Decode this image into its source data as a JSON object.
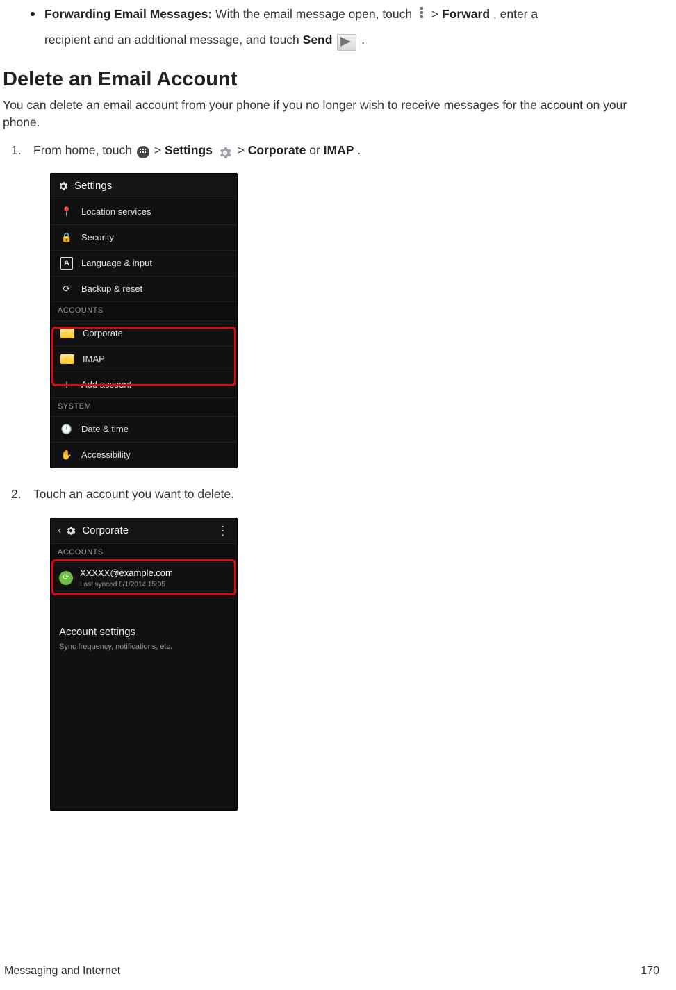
{
  "bullet": {
    "title": "Forwarding Email Messages:",
    "line1a": " With the email message open, touch ",
    "line1b": " > ",
    "forward": "Forward",
    "line1c": ", enter a",
    "line2a": "recipient and an additional message, and touch ",
    "send": "Send",
    "line2b": " ",
    "period": "."
  },
  "section_title": "Delete an Email Account",
  "section_para": "You can delete an email account from your phone if you no longer wish to receive messages for the account on your phone.",
  "step1": {
    "num": "1.",
    "a": "From home, touch ",
    "b": " > ",
    "settings": "Settings",
    "c": " ",
    "d": " > ",
    "corporate": "Corporate",
    "or": " or ",
    "imap": "IMAP",
    "period": "."
  },
  "step2": {
    "num": "2.",
    "text": "Touch an account you want to delete."
  },
  "phone1": {
    "header_title": "Settings",
    "rows": [
      {
        "icon": "📍",
        "label": "Location services"
      },
      {
        "icon": "🔒",
        "label": "Security"
      },
      {
        "icon": "A",
        "label": "Language & input"
      },
      {
        "icon": "⟳",
        "label": "Backup & reset"
      }
    ],
    "accounts_label": "ACCOUNTS",
    "accounts": [
      {
        "label": "Corporate"
      },
      {
        "label": "IMAP"
      }
    ],
    "add_account": "Add account",
    "system_label": "SYSTEM",
    "system": [
      {
        "icon": "🕘",
        "label": "Date & time"
      },
      {
        "icon": "✋",
        "label": "Accessibility"
      }
    ]
  },
  "phone2": {
    "header_title": "Corporate",
    "accounts_label": "ACCOUNTS",
    "email": "XXXXX@example.com",
    "synced": "Last synced 8/1/2014 15:05",
    "acct_settings": "Account settings",
    "acct_settings_sub": "Sync frequency, notifications, etc."
  },
  "footer": {
    "left": "Messaging and Internet",
    "right": "170"
  }
}
